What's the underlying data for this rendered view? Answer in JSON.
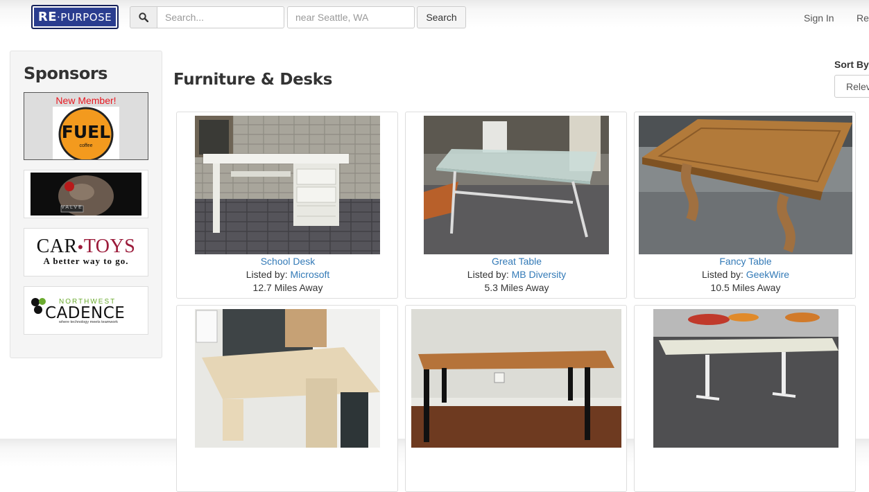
{
  "header": {
    "logo_prefix": "RE",
    "logo_suffix": "·PURPOSE",
    "search_placeholder": "Search...",
    "location_placeholder": "near Seattle, WA",
    "search_button": "Search",
    "sign_in": "Sign In",
    "register": "Reg"
  },
  "sidebar": {
    "title": "Sponsors",
    "sponsors": [
      {
        "badge": "New Member!",
        "name": "FUEL",
        "tagline": "coffee"
      },
      {
        "name": "VALVE"
      },
      {
        "name_part1": "CAR",
        "name_part2": "TOYS",
        "tagline": "A better way to go."
      },
      {
        "name_top": "NORTHWEST",
        "name": "CADENCE",
        "tagline": "where technology meets teamwork"
      }
    ]
  },
  "main": {
    "title": "Furniture & Desks",
    "sort_label": "Sort By",
    "sort_value": "Relev",
    "listed_prefix": "Listed by:",
    "items": [
      {
        "title": "School Desk",
        "lister": "Microsoft",
        "distance": "12.7 Miles Away"
      },
      {
        "title": "Great Table",
        "lister": "MB Diversity",
        "distance": "5.3 Miles Away"
      },
      {
        "title": "Fancy Table",
        "lister": "GeekWire",
        "distance": "10.5 Miles Away"
      },
      {
        "title": "",
        "lister": "",
        "distance": ""
      },
      {
        "title": "",
        "lister": "",
        "distance": ""
      },
      {
        "title": "",
        "lister": "",
        "distance": ""
      }
    ]
  },
  "colors": {
    "brand": "#2a3d8f",
    "link": "#337ab7",
    "badge_red": "#e8161f",
    "fuel_orange": "#f39a1e"
  }
}
